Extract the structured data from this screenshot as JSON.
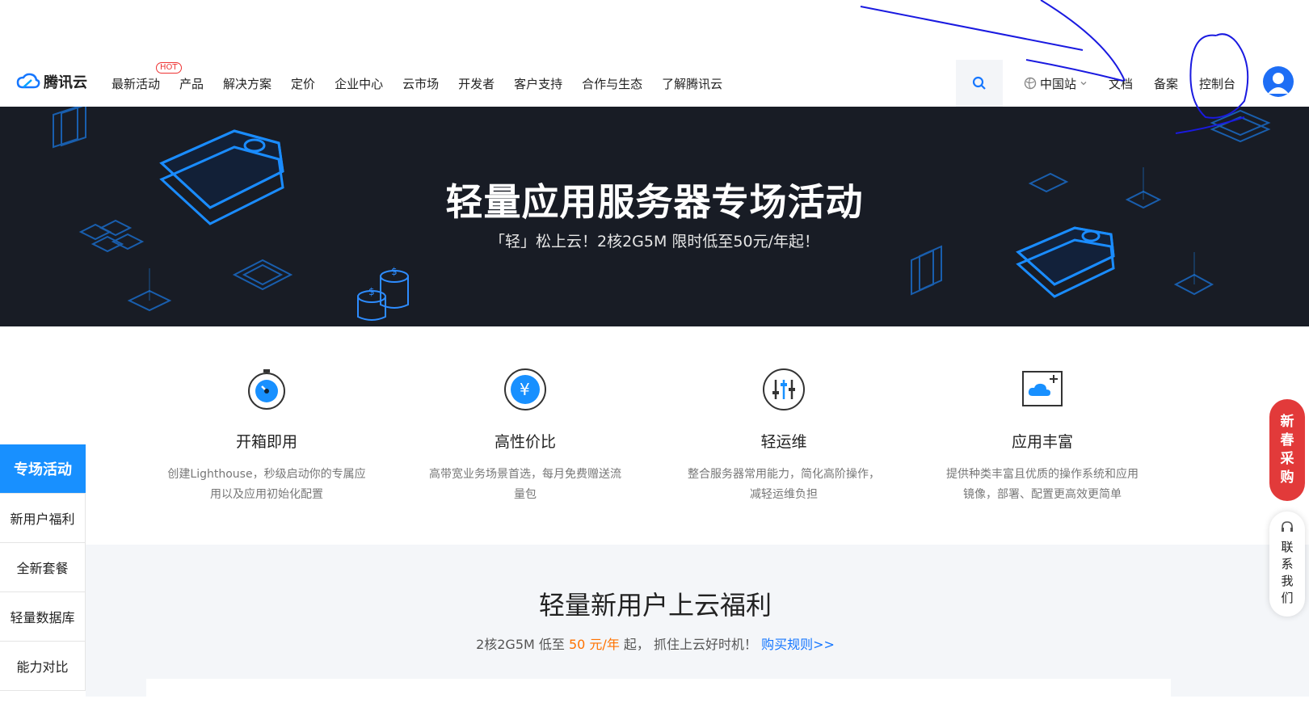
{
  "header": {
    "logo_text": "腾讯云",
    "hot_badge": "HOT",
    "nav": [
      "最新活动",
      "产品",
      "解决方案",
      "定价",
      "企业中心",
      "云市场",
      "开发者",
      "客户支持",
      "合作与生态",
      "了解腾讯云"
    ],
    "region": "中国站",
    "links": [
      "文档",
      "备案",
      "控制台"
    ]
  },
  "banner": {
    "title": "轻量应用服务器专场活动",
    "subtitle": "「轻」松上云！2核2G5M 限时低至50元/年起！"
  },
  "features": [
    {
      "title": "开箱即用",
      "desc_line1": "创建Lighthouse，秒级启动你的专属应",
      "desc_line2": "用以及应用初始化配置",
      "icon": "stopwatch-icon"
    },
    {
      "title": "高性价比",
      "desc_line1": "高带宽业务场景首选，每月免费赠送流",
      "desc_line2": "量包",
      "icon": "yuan-icon"
    },
    {
      "title": "轻运维",
      "desc_line1": "整合服务器常用能力，简化高阶操作，",
      "desc_line2": "减轻运维负担",
      "icon": "sliders-icon"
    },
    {
      "title": "应用丰富",
      "desc_line1": "提供种类丰富且优质的操作系统和应用",
      "desc_line2": "镜像，部署、配置更高效更简单",
      "icon": "cloud-plus-icon"
    }
  ],
  "section": {
    "title": "轻量新用户上云福利",
    "sub_prefix": "2核2G5M 低至 ",
    "sub_price": "50 元/年",
    "sub_suffix": " 起，  抓住上云好时机！ ",
    "sub_link": "购买规则>>"
  },
  "sidemenu": [
    "专场活动",
    "新用户福利",
    "全新套餐",
    "轻量数据库",
    "能力对比"
  ],
  "float": {
    "promo": [
      "新",
      "春",
      "采",
      "购"
    ],
    "contact": [
      "联",
      "系",
      "我",
      "们"
    ]
  },
  "colors": {
    "accent": "#1890ff",
    "banner_bg": "#181c25",
    "promo_red": "#e23a3a",
    "price_orange": "#ff7200"
  }
}
